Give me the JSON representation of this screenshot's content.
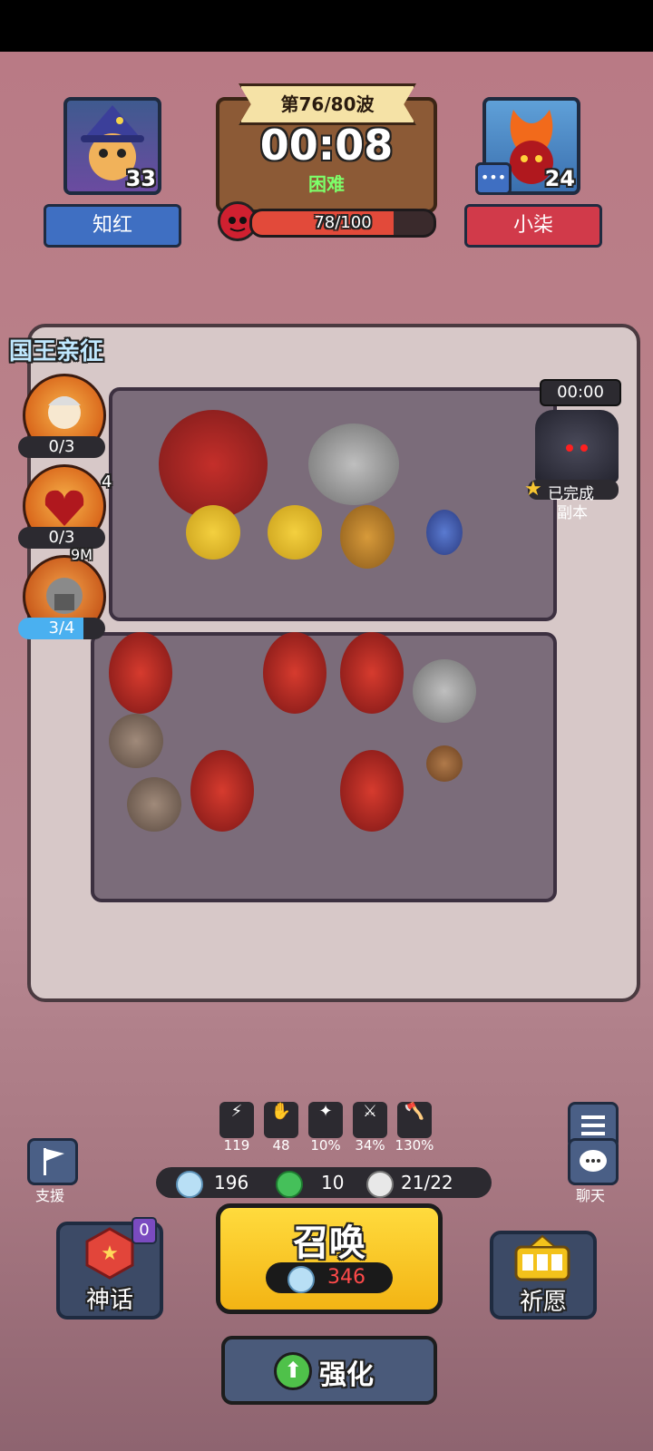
{
  "wave": {
    "label": "第76/80波",
    "timer": "00:08",
    "difficulty": "困难"
  },
  "boss_hp": {
    "text": "78/100",
    "fraction": 0.78
  },
  "player_left": {
    "name": "知红",
    "level": "33"
  },
  "player_right": {
    "name": "小柒",
    "level": "24"
  },
  "king_event": {
    "label": "国王亲征"
  },
  "hero_counters": [
    "0/3",
    "0/3",
    "3/4"
  ],
  "damage_text": "4",
  "dps_text": "9M",
  "dungeon": {
    "timer": "00:00",
    "status_line1": "已完成",
    "status_line2": "副本"
  },
  "stats": [
    "119",
    "48",
    "10%",
    "34%",
    "130%"
  ],
  "resources": {
    "silver": "196",
    "gems": "10",
    "units": "21/22"
  },
  "side_buttons": {
    "function": "功能",
    "chat": "聊天",
    "support": "支援"
  },
  "myth": {
    "label": "神话",
    "badge": "0"
  },
  "summon": {
    "label": "召唤",
    "cost": "346"
  },
  "wish": {
    "label": "祈愿"
  },
  "enhance": {
    "label": "强化"
  },
  "colors": {
    "left_team": "#3f6fc2",
    "right_team": "#d13a4a",
    "summon_yellow": "#f3c21b",
    "hp_red": "#e24a3a"
  }
}
